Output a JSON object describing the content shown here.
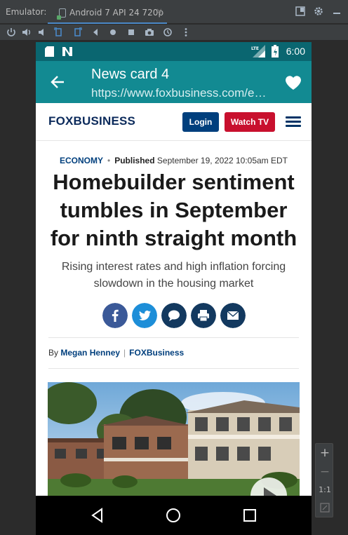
{
  "emulator": {
    "label": "Emulator:",
    "tab_title": "Android 7 API 24 720p",
    "tab_close": "×",
    "zoom": {
      "plus": "+",
      "minus": "−",
      "one_to_one": "1:1"
    }
  },
  "statusbar": {
    "time": "6:00",
    "network": "LTE"
  },
  "appbar": {
    "title": "News card 4",
    "subtitle": "https://www.foxbusiness.com/economy/homebuilder-sentiment-tumbles-september"
  },
  "site": {
    "logo_fox": "FOX",
    "logo_business": "BUSINESS",
    "login_label": "Login",
    "watch_label": "Watch TV"
  },
  "article": {
    "category": "ECONOMY",
    "dot": "•",
    "published_label": "Published",
    "published_date": "September 19, 2022 10:05am EDT",
    "headline": "Homebuilder sentiment tumbles in September for ninth straight month",
    "subhead": "Rising interest rates and high inflation forcing slowdown in the housing market",
    "by": "By",
    "author": "Megan Henney",
    "outlet": "FOXBusiness"
  },
  "colors": {
    "statusbar": "#0a6670",
    "appbar": "#128a92",
    "navy": "#003f7d",
    "red": "#c8102e",
    "share_facebook": "#3b5998",
    "share_twitter": "#1d8ed8",
    "share_dark": "#13395f"
  },
  "icons": [
    "back-arrow-icon",
    "heart-icon",
    "menu-icon",
    "facebook-icon",
    "twitter-icon",
    "comment-icon",
    "print-icon",
    "email-icon",
    "nav-back-icon",
    "nav-home-icon",
    "nav-recents-icon"
  ]
}
